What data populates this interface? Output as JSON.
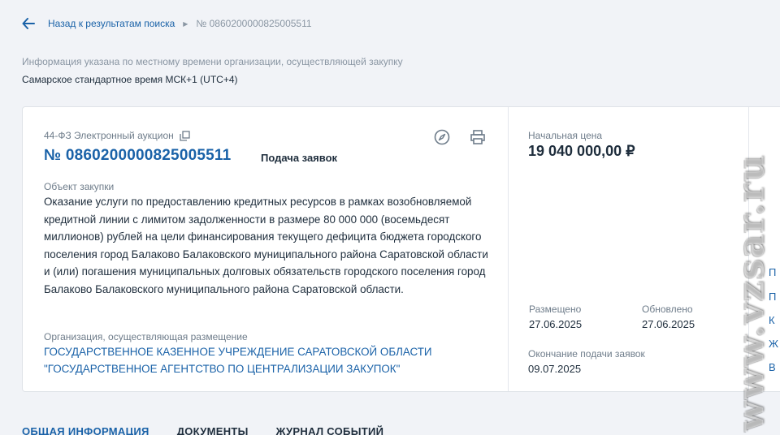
{
  "breadcrumb": {
    "back_label": "Назад к результатам поиска",
    "current": "№ 0860200000825005511"
  },
  "timezone": {
    "note": "Информация указана по местному времени организации, осуществляющей закупку",
    "value": "Самарское стандартное время МСК+1 (UTC+4)"
  },
  "procurement": {
    "law_type": "44-ФЗ Электронный аукцион",
    "number": "№ 0860200000825005511",
    "status": "Подача заявок",
    "object_label": "Объект закупки",
    "object_text": "Оказание услуги по предоставлению кредитных ресурсов в рамках возобновляемой кредитной линии с лимитом задолженности в размере 80 000 000 (восемьдесят миллионов) рублей на цели финансирования текущего дефицита бюджета городского поселения город Балаково Балаковского муниципального района Саратовской области и (или) погашения муниципальных долговых обязательств городского поселения город Балаково Балаковского муниципального района Саратовской области.",
    "org_label": "Организация, осуществляющая размещение",
    "org_name": "ГОСУДАРСТВЕННОЕ КАЗЕННОЕ УЧРЕЖДЕНИЕ САРАТОВСКОЙ ОБЛАСТИ \"ГОСУДАРСТВЕННОЕ АГЕНТСТВО ПО ЦЕНТРАЛИЗАЦИИ ЗАКУПОК\""
  },
  "price": {
    "label": "Начальная цена",
    "value": "19 040 000,00 ₽"
  },
  "dates": {
    "posted_label": "Размещено",
    "posted_value": "27.06.2025",
    "updated_label": "Обновлено",
    "updated_value": "27.06.2025",
    "deadline_label": "Окончание подачи заявок",
    "deadline_value": "09.07.2025"
  },
  "side_nav_letters": [
    "П",
    "П",
    "К",
    "Ж",
    "В"
  ],
  "watermark": "www.vzsar.ru",
  "tabs": [
    {
      "label": "ОБЩАЯ ИНФОРМАЦИЯ",
      "active": true
    },
    {
      "label": "ДОКУМЕНТЫ",
      "active": false
    },
    {
      "label": "ЖУРНАЛ СОБЫТИЙ",
      "active": false
    }
  ],
  "colors": {
    "accent": "#1a62a8",
    "text": "#1e2d3c",
    "muted": "#6e7c8a",
    "background": "#f1f3f7"
  },
  "icons": [
    "back-arrow-icon",
    "chevron-right-icon",
    "copy-icon",
    "compass-icon",
    "print-icon"
  ]
}
